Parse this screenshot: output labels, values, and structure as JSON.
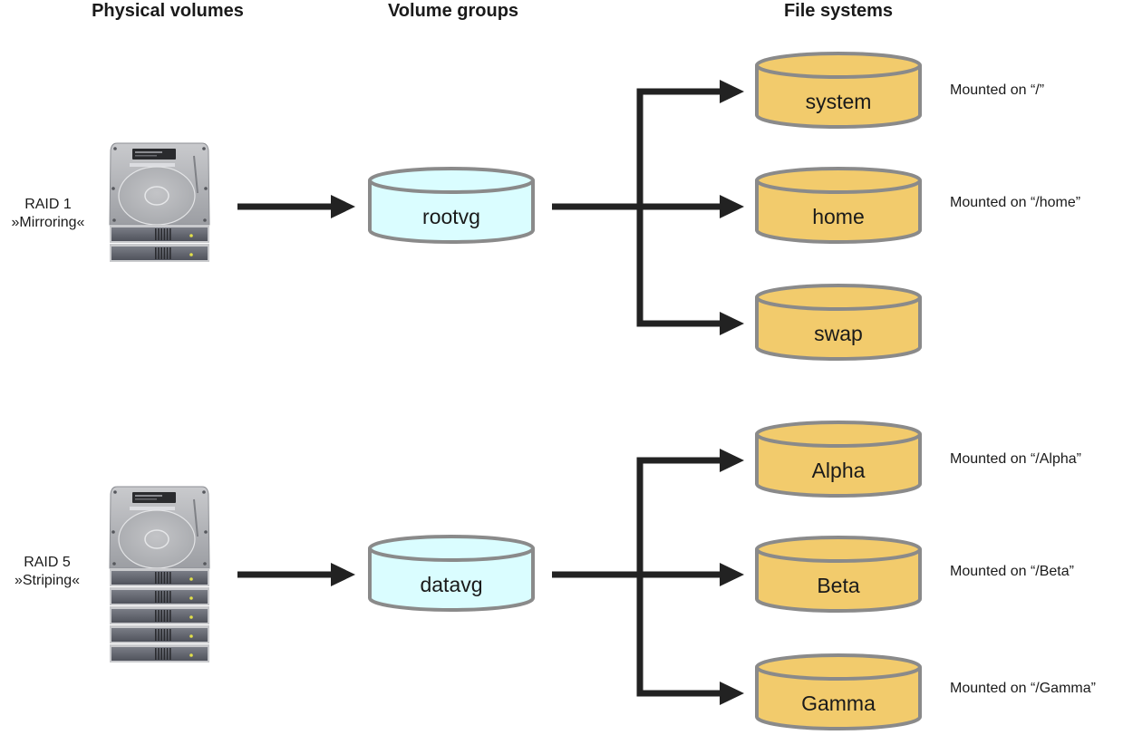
{
  "headers": {
    "physical_volumes": "Physical volumes",
    "volume_groups": "Volume groups",
    "file_systems": "File systems"
  },
  "colors": {
    "volume_group_fill": "#dafdff",
    "file_system_fill": "#f2cb6c",
    "cylinder_stroke": "#8a8a8a",
    "arrow": "#222222"
  },
  "groups": [
    {
      "raid": {
        "line1": "RAID 1",
        "line2": "»Mirroring«",
        "icon": "hard-drive-stack-icon",
        "drives": 2
      },
      "volume_group": "rootvg",
      "file_systems": [
        {
          "name": "system",
          "mount": "Mounted on “/”"
        },
        {
          "name": "home",
          "mount": "Mounted on “/home”"
        },
        {
          "name": "swap",
          "mount": ""
        }
      ]
    },
    {
      "raid": {
        "line1": "RAID 5",
        "line2": "»Striping«",
        "icon": "hard-drive-stack-icon",
        "drives": 5
      },
      "volume_group": "datavg",
      "file_systems": [
        {
          "name": "Alpha",
          "mount": "Mounted on “/Alpha”"
        },
        {
          "name": "Beta",
          "mount": "Mounted on “/Beta”"
        },
        {
          "name": "Gamma",
          "mount": "Mounted on “/Gamma”"
        }
      ]
    }
  ]
}
